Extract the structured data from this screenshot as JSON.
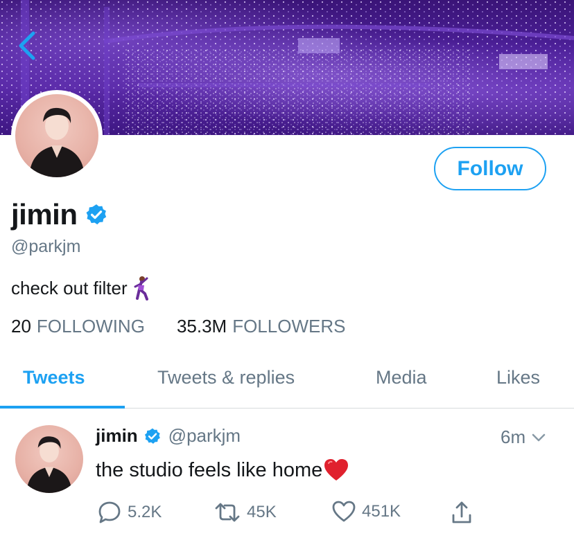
{
  "header": {
    "back_icon": "chevron-left-icon"
  },
  "profile": {
    "display_name": "jimin",
    "verified_icon": "verified-badge-icon",
    "handle": "@parkjm",
    "bio": "check out filter",
    "bio_emoji": "dancer-emoji",
    "follow_label": "Follow",
    "following_count": "20",
    "following_label": "FOLLOWING",
    "followers_count": "35.3M",
    "followers_label": "FOLLOWERS"
  },
  "tabs": [
    {
      "label": "Tweets",
      "active": true
    },
    {
      "label": "Tweets & replies",
      "active": false
    },
    {
      "label": "Media",
      "active": false
    },
    {
      "label": "Likes",
      "active": false
    }
  ],
  "tweet": {
    "name": "jimin",
    "handle": "@parkjm",
    "time": "6m",
    "text": "the studio feels like home",
    "text_emoji": "red-heart-emoji",
    "replies": "5.2K",
    "retweets": "45K",
    "likes": "451K"
  },
  "colors": {
    "accent": "#1da1f2",
    "muted": "#657786",
    "banner": "#4b1f97"
  }
}
